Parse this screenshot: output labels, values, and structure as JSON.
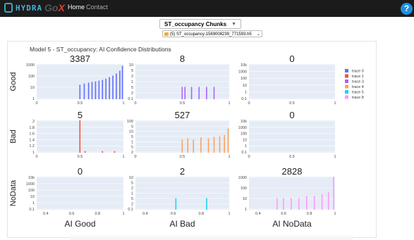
{
  "navbar": {
    "brand": "HYDRA",
    "brand2_prefix": "Go",
    "brand2_suffix": "X",
    "home": "Home",
    "contact": "Contact",
    "help": "?"
  },
  "chunk_select": {
    "value": "ST_occupancy Chunks"
  },
  "file_select": {
    "value": "(5) ST_occupancy-1569008239_771593.h5"
  },
  "figure": {
    "title": "Model 5 - ST_occupancy: AI Confidence Distributions",
    "row_labels": [
      "Good",
      "Bad",
      "NoData"
    ],
    "col_labels": [
      "AI Good",
      "AI Bad",
      "AI NoData"
    ],
    "legend": [
      {
        "name": "trace 0",
        "color": "#636efa"
      },
      {
        "name": "trace 1",
        "color": "#ef553b"
      },
      {
        "name": "trace 3",
        "color": "#ab63fa"
      },
      {
        "name": "trace 4",
        "color": "#ffa15a"
      },
      {
        "name": "trace 5",
        "color": "#19d3f3"
      },
      {
        "name": "trace 8",
        "color": "#ff97ff"
      }
    ]
  },
  "chart_data": [
    {
      "type": "bar",
      "title": "3387",
      "color": "#636efa",
      "yticks": [
        "1000",
        "100",
        "10",
        "1"
      ],
      "xticks": [
        "0",
        "0.5",
        "1"
      ],
      "xlim": [
        0,
        1
      ],
      "log_y": true,
      "x": [
        0.5,
        0.55,
        0.6,
        0.64,
        0.68,
        0.72,
        0.76,
        0.8,
        0.84,
        0.88,
        0.92,
        0.96,
        0.99
      ],
      "values": [
        2,
        3,
        4,
        5,
        6,
        8,
        10,
        15,
        25,
        40,
        80,
        200,
        1000
      ]
    },
    {
      "type": "bar",
      "title": "8",
      "color": "#ab63fa",
      "yticks": [
        "10",
        "5",
        "2",
        "1",
        "5",
        "2",
        "0.1"
      ],
      "xticks": [
        "0",
        "0.5",
        "1"
      ],
      "xlim": [
        0,
        1
      ],
      "log_y": true,
      "x": [
        0.5,
        0.53,
        0.6,
        0.68,
        0.76,
        0.84
      ],
      "values": [
        1,
        1,
        1,
        1,
        1,
        1
      ]
    },
    {
      "type": "bar",
      "title": "0",
      "color": "#636efa",
      "yticks": [
        "10k",
        "1000",
        "100",
        "10",
        "1",
        "0.1"
      ],
      "xticks": [
        "0",
        "0.5",
        "1"
      ],
      "xlim": [
        0,
        1
      ],
      "log_y": true,
      "x": [],
      "values": []
    },
    {
      "type": "bar",
      "title": "5",
      "color": "#ef553b",
      "yticks": [
        "2",
        "1.8",
        "1.6",
        "1.4",
        "1.2",
        "1"
      ],
      "xticks": [
        "0",
        "0.5",
        "1"
      ],
      "xlim": [
        0,
        1
      ],
      "ylim": [
        1,
        2
      ],
      "log_y": false,
      "x": [
        0.5,
        0.56,
        0.76,
        0.9
      ],
      "values": [
        2,
        1.05,
        1.05,
        1.05
      ]
    },
    {
      "type": "bar",
      "title": "527",
      "color": "#ffa15a",
      "yticks": [
        "100",
        "5",
        "10",
        "5",
        "1",
        "5",
        "2"
      ],
      "xticks": [
        "0",
        "0.5",
        "1"
      ],
      "xlim": [
        0,
        1
      ],
      "log_y": true,
      "x": [
        0.5,
        0.56,
        0.62,
        0.7,
        0.78,
        0.84,
        0.9,
        0.95,
        0.99
      ],
      "values": [
        2,
        3,
        2,
        4,
        3,
        5,
        6,
        10,
        100
      ]
    },
    {
      "type": "bar",
      "title": "0",
      "color": "#19d3f3",
      "yticks": [
        "10k",
        "1000",
        "100",
        "10",
        "1",
        "0.1"
      ],
      "xticks": [
        "0",
        "0.5",
        "1"
      ],
      "xlim": [
        0,
        1
      ],
      "log_y": true,
      "x": [],
      "values": []
    },
    {
      "type": "bar",
      "title": "0",
      "color": "#ef553b",
      "yticks": [
        "10k",
        "1000",
        "100",
        "10",
        "1",
        "0.1"
      ],
      "xticks": [
        "0.4",
        "0.6",
        "0.8",
        "1"
      ],
      "xlim": [
        0.33,
        1
      ],
      "log_y": true,
      "x": [],
      "values": []
    },
    {
      "type": "bar",
      "title": "2",
      "color": "#19d3f3",
      "yticks": [
        "10",
        "5",
        "2",
        "1",
        "5",
        "2",
        "0.1"
      ],
      "xticks": [
        "0.4",
        "0.6",
        "0.8",
        "1"
      ],
      "xlim": [
        0.33,
        1
      ],
      "log_y": true,
      "x": [
        0.62,
        0.84
      ],
      "values": [
        1,
        1
      ]
    },
    {
      "type": "bar",
      "title": "2828",
      "color": "#ff97ff",
      "yticks": [
        "1000",
        "100",
        "10",
        "1"
      ],
      "xticks": [
        "0.4",
        "0.6",
        "0.8",
        "1"
      ],
      "xlim": [
        0.33,
        1
      ],
      "log_y": true,
      "x": [
        0.55,
        0.6,
        0.66,
        0.72,
        0.78,
        0.84,
        0.9,
        0.95,
        0.99
      ],
      "values": [
        1,
        1,
        1,
        1,
        2,
        2,
        4,
        8,
        2000
      ]
    }
  ]
}
